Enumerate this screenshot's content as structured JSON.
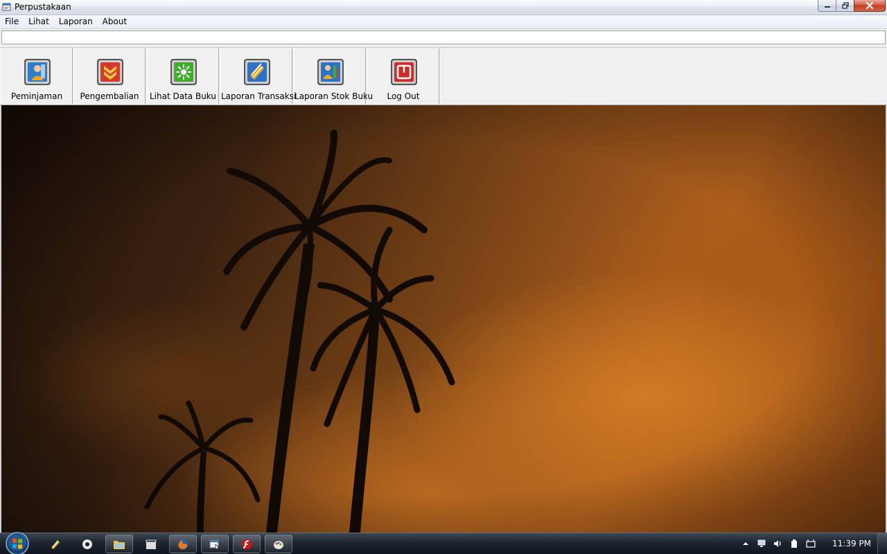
{
  "window": {
    "title": "Perpustakaan",
    "icon": "app-icon",
    "controls": [
      "minimize-icon",
      "maximize-icon",
      "close-icon"
    ]
  },
  "menu": {
    "items": [
      {
        "label": "File"
      },
      {
        "label": "Lihat"
      },
      {
        "label": "Laporan"
      },
      {
        "label": "About"
      }
    ]
  },
  "address": {
    "value": ""
  },
  "toolbar": {
    "buttons": [
      {
        "label": "Peminjaman",
        "icon": "borrow-user-icon",
        "accent": "#2d7ec8"
      },
      {
        "label": "Pengembalian",
        "icon": "return-arrows-icon",
        "accent": "#d43a2a"
      },
      {
        "label": "Lihat Data Buku",
        "icon": "view-books-icon",
        "accent": "#3fae2a"
      },
      {
        "label": "Laporan Transaksi",
        "icon": "transaction-report-icon",
        "accent": "#e3a21a"
      },
      {
        "label": "Laporan Stok Buku",
        "icon": "stock-report-icon",
        "accent": "#2c72c7"
      },
      {
        "label": "Log Out",
        "icon": "logout-power-icon",
        "accent": "#d02a2a"
      }
    ]
  },
  "taskbar": {
    "start": "windows-start-icon",
    "apps": [
      {
        "icon": "quick-launch-icon",
        "active": false
      },
      {
        "icon": "media-player-icon",
        "active": false
      },
      {
        "icon": "explorer-folder-icon",
        "active": true
      },
      {
        "icon": "movie-clapper-icon",
        "active": false
      },
      {
        "icon": "firefox-icon",
        "active": true
      },
      {
        "icon": "app-window-icon",
        "active": true
      },
      {
        "icon": "flash-app-icon",
        "active": true
      },
      {
        "icon": "paint-app-icon",
        "active": true
      }
    ],
    "tray": {
      "icons": [
        "show-hidden-icons-icon",
        "network-icon",
        "volume-icon",
        "power-icon",
        "action-center-icon"
      ],
      "clock": "11:39 PM"
    }
  }
}
